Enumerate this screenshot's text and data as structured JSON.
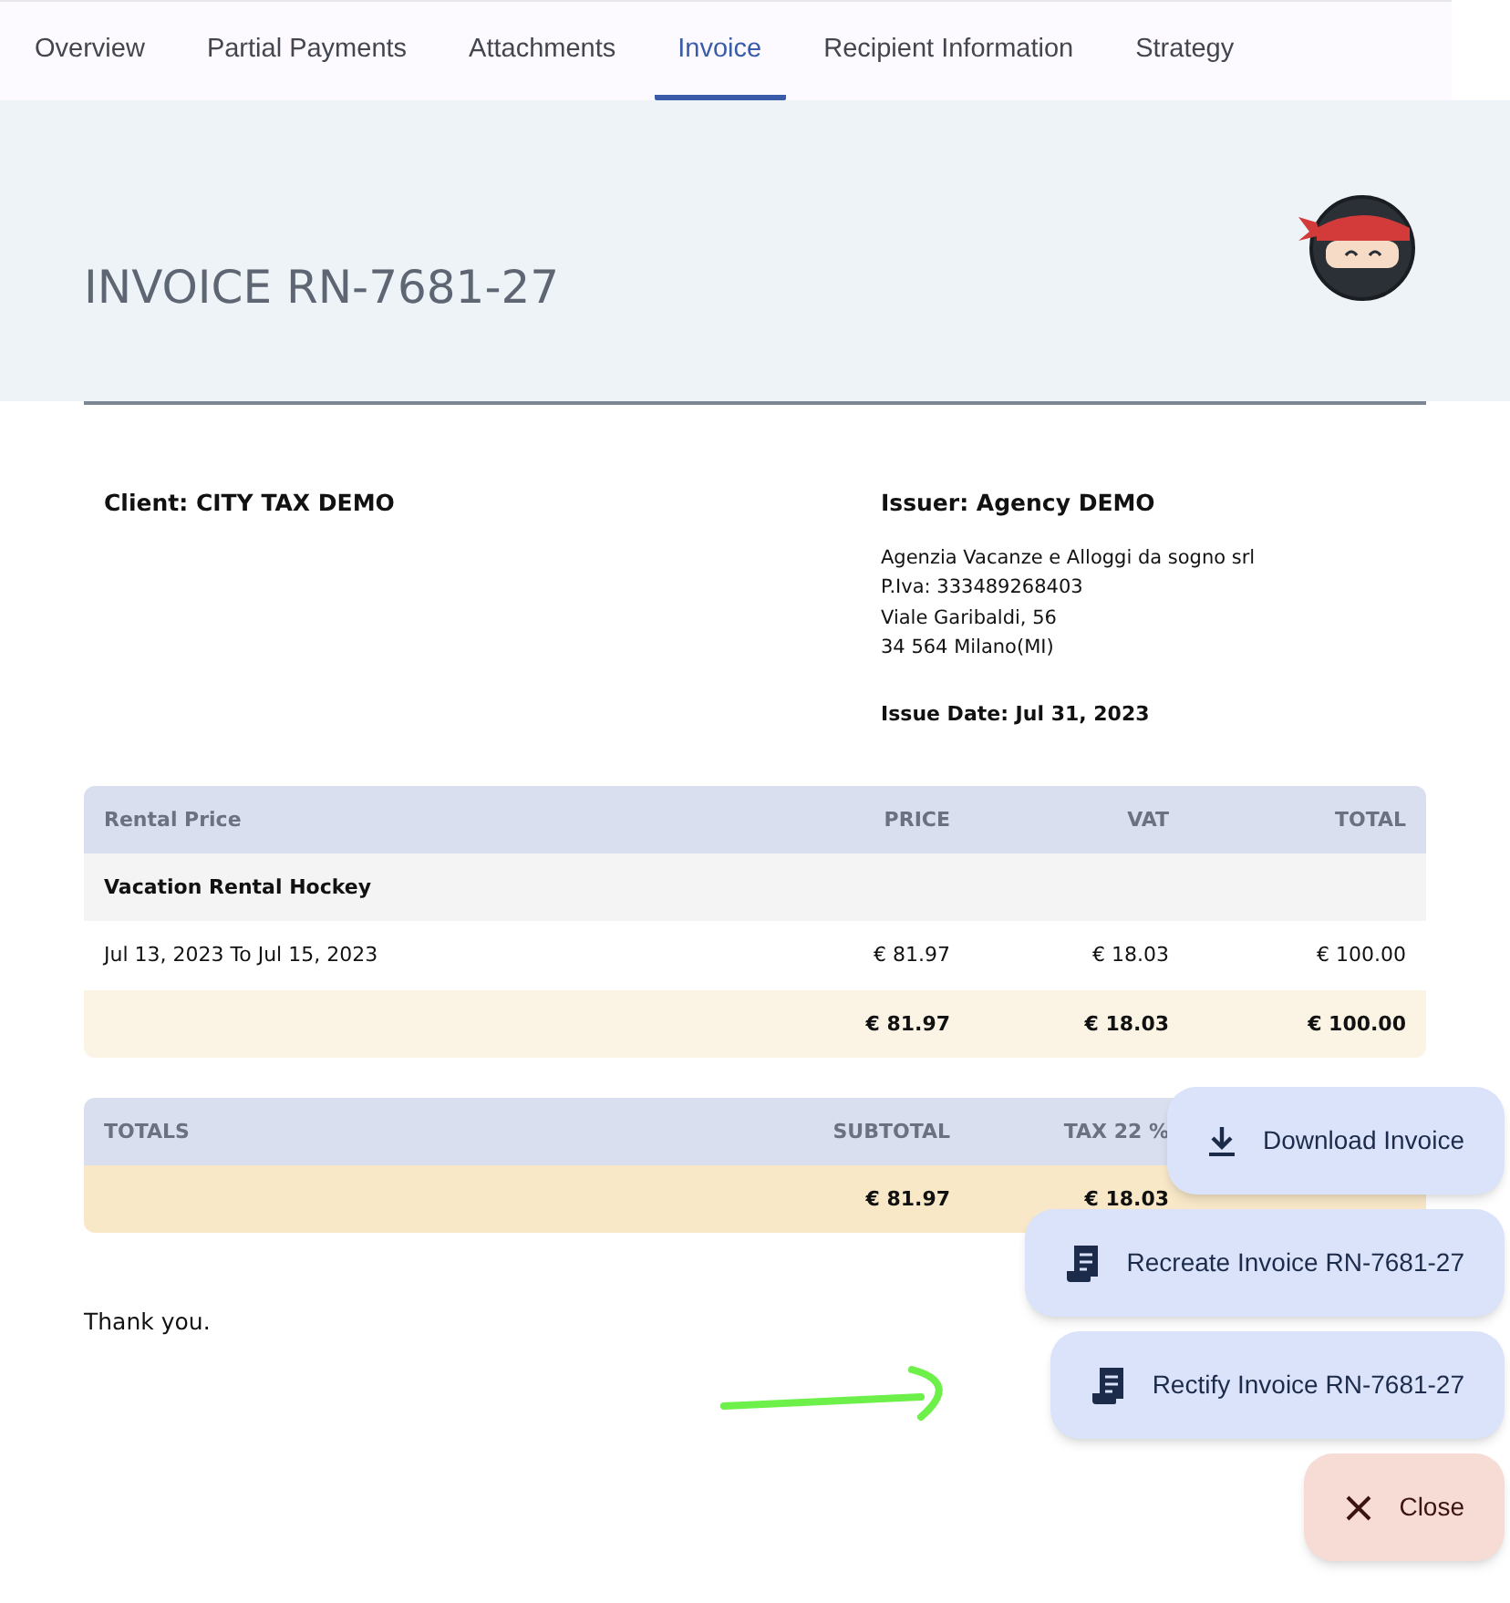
{
  "tabs": [
    {
      "label": "Overview",
      "selected": false
    },
    {
      "label": "Partial Payments",
      "selected": false
    },
    {
      "label": "Attachments",
      "selected": false
    },
    {
      "label": "Invoice",
      "selected": true
    },
    {
      "label": "Recipient Information",
      "selected": false
    },
    {
      "label": "Strategy",
      "selected": false
    }
  ],
  "invoice": {
    "title": "INVOICE RN-7681-27",
    "client": "Client: CITY TAX DEMO",
    "issuer": {
      "title": "Issuer: Agency DEMO",
      "lines": [
        "Agenzia Vacanze e Alloggi da sogno srl",
        "P.Iva: 333489268403",
        "Viale Garibaldi, 56",
        "34 564 Milano(MI)"
      ],
      "issue_date": "Issue Date: Jul 31, 2023"
    },
    "items_table": {
      "columns": [
        "Rental Price",
        "PRICE",
        "VAT",
        "TOTAL"
      ],
      "group": "Vacation Rental Hockey",
      "rows": [
        [
          "Jul 13, 2023 To Jul 15, 2023",
          "€ 81.97",
          "€ 18.03",
          "€ 100.00"
        ]
      ],
      "sum": {
        "price": "€ 81.97",
        "vat": "€ 18.03",
        "total": "€ 100.00"
      }
    },
    "totals_table": {
      "columns": [
        "TOTALS",
        "SUBTOTAL",
        "TAX 22 %"
      ],
      "row": {
        "subtotal": "€ 81.97",
        "tax": "€ 18.03"
      }
    },
    "closing": "Thank you."
  },
  "actions": [
    {
      "kind": "download",
      "label": "Download Invoice"
    },
    {
      "kind": "receipt",
      "label": "Recreate Invoice RN-7681-27"
    },
    {
      "kind": "receipt",
      "label": "Rectify Invoice RN-7681-27"
    },
    {
      "kind": "close",
      "label": "Close"
    }
  ]
}
